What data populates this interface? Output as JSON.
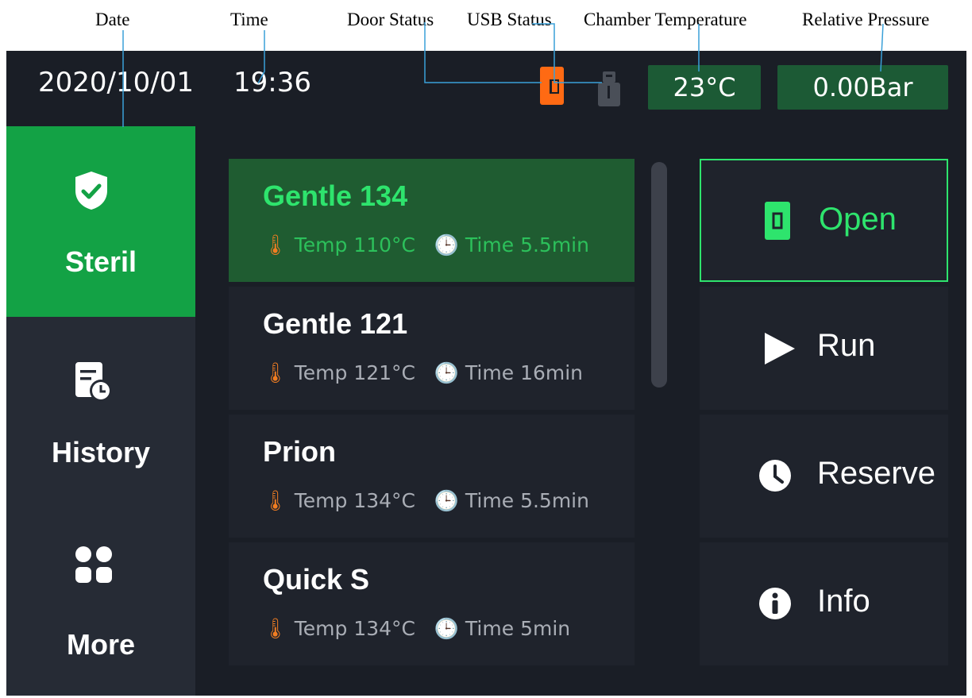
{
  "annotations": {
    "date": "Date",
    "time": "Time",
    "door_status": "Door Status",
    "usb_status": "USB Status",
    "chamber_temperature": "Chamber Temperature",
    "relative_pressure": "Relative Pressure"
  },
  "status_bar": {
    "date": "2020/10/01",
    "time": "19:36",
    "door_icon": "door-icon",
    "usb_icon": "usb-icon",
    "temperature": "23°C",
    "pressure": "0.00Bar"
  },
  "nav": {
    "items": [
      {
        "label": "Steril",
        "icon": "shield-check-icon",
        "active": true
      },
      {
        "label": "History",
        "icon": "history-icon",
        "active": false
      },
      {
        "label": "More",
        "icon": "grid-icon",
        "active": false
      }
    ]
  },
  "programs": [
    {
      "name": "Gentle 134",
      "temp_label": "Temp",
      "temp": "110°C",
      "time_label": "Time",
      "time": "5.5min",
      "selected": true
    },
    {
      "name": "Gentle 121",
      "temp_label": "Temp",
      "temp": "121°C",
      "time_label": "Time",
      "time": "16min",
      "selected": false
    },
    {
      "name": "Prion",
      "temp_label": "Temp",
      "temp": "134°C",
      "time_label": "Time",
      "time": "5.5min",
      "selected": false
    },
    {
      "name": "Quick S",
      "temp_label": "Temp",
      "temp": "134°C",
      "time_label": "Time",
      "time": "5min",
      "selected": false
    }
  ],
  "actions": [
    {
      "label": "Open",
      "icon": "door-open-icon"
    },
    {
      "label": "Run",
      "icon": "play-icon"
    },
    {
      "label": "Reserve",
      "icon": "clock-icon"
    },
    {
      "label": "Info",
      "icon": "info-icon"
    }
  ],
  "colors": {
    "screen_bg": "#1a1e26",
    "nav_bg": "#262b35",
    "accent_green": "#13a245",
    "selected_text": "#2ee46d",
    "door_orange": "#ff6a13",
    "thermo_orange": "#f07d22",
    "clock_blue": "#7b86f0",
    "badge_green": "#1c5a35",
    "callout_line": "#3aa0d8"
  }
}
